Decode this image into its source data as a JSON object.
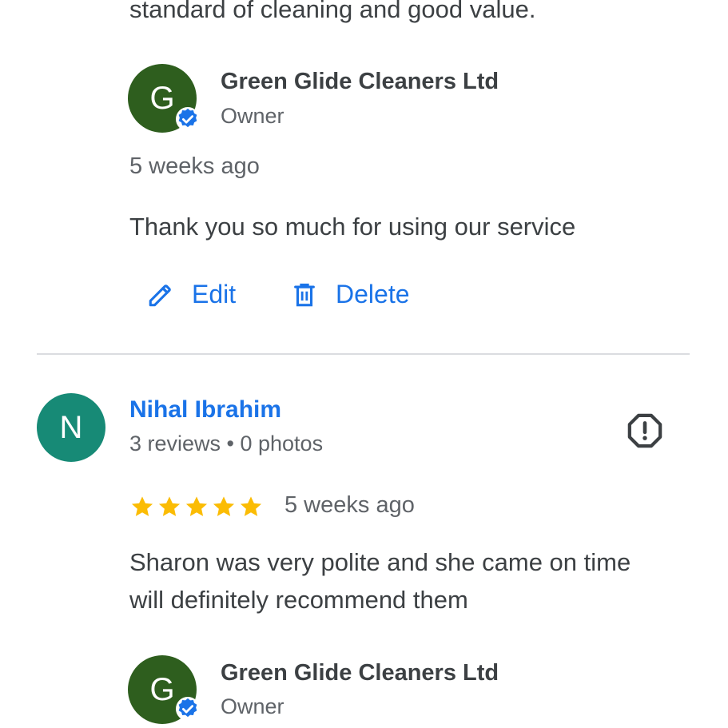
{
  "previous_review": {
    "text_tail": "standard of cleaning and good value."
  },
  "owner_reply_1": {
    "avatar_initial": "G",
    "name": "Green Glide Cleaners Ltd",
    "role": "Owner",
    "time": "5 weeks ago",
    "text": "Thank you so much for using our service",
    "actions": {
      "edit_label": "Edit",
      "delete_label": "Delete"
    }
  },
  "review": {
    "avatar_initial": "N",
    "reviewer_name": "Nihal Ibrahim",
    "meta": "3 reviews • 0 photos",
    "rating": 5,
    "time": "5 weeks ago",
    "text_line1": "Sharon was very polite and she came on time",
    "text_line2": "will definitely recommend them"
  },
  "owner_reply_2": {
    "avatar_initial": "G",
    "name": "Green Glide Cleaners Ltd",
    "role": "Owner"
  },
  "colors": {
    "accent_blue": "#1a73e8",
    "star_yellow": "#fbbc04",
    "owner_avatar": "#2e5e1e",
    "reviewer_avatar": "#178a76"
  }
}
